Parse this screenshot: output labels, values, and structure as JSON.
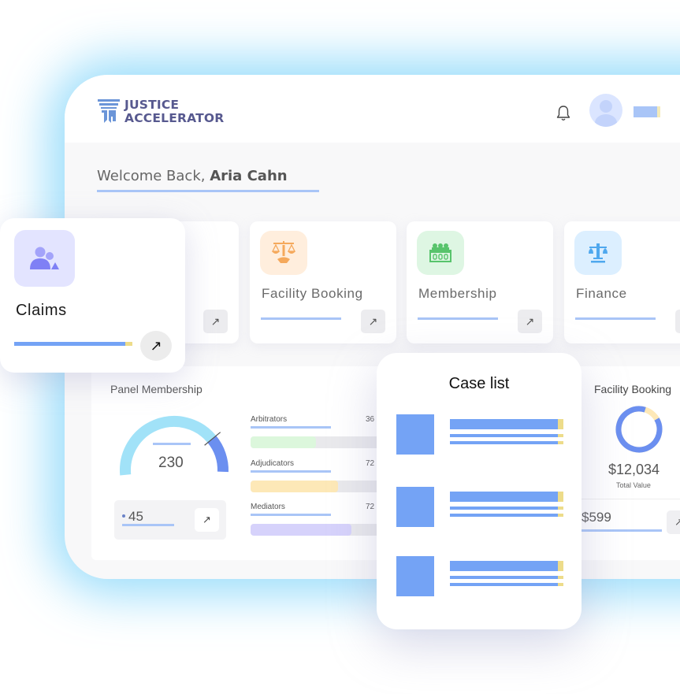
{
  "app": {
    "brand_line1": "JUSTICE",
    "brand_line2": "ACCELERATOR",
    "logo_icon": "pillar-logo-icon"
  },
  "header": {
    "notification_icon": "bell-icon",
    "avatar_icon": "user-avatar-icon"
  },
  "welcome": {
    "prefix": "Welcome Back, ",
    "name": "Aria Cahn"
  },
  "modules": [
    {
      "label": "Claims",
      "icon": "people-group-icon",
      "icon_bg": "#e3e4ff",
      "icon_color": "#7f80f5"
    },
    {
      "label": "Facility Booking",
      "icon": "scales-handshake-icon",
      "icon_bg": "#ffeedd",
      "icon_color": "#f5a95c"
    },
    {
      "label": "Membership",
      "icon": "panel-bench-icon",
      "icon_bg": "#def6e3",
      "icon_color": "#58c46c"
    },
    {
      "label": "Finance",
      "icon": "scales-icon",
      "icon_bg": "#dcefff",
      "icon_color": "#4fa8ee"
    }
  ],
  "panel_membership": {
    "title": "Panel Membership",
    "gauge_value": "230",
    "gauge_fraction": 0.78,
    "sub_value": "45",
    "rows": [
      {
        "name": "Arbitrators",
        "count": "36",
        "fraction": 0.49,
        "color": "#dcf7dc"
      },
      {
        "name": "Adjudicators",
        "count": "72",
        "fraction": 0.65,
        "color": "#fde8b7"
      },
      {
        "name": "Mediators",
        "count": "72",
        "fraction": 0.75,
        "color": "#d6d2fb"
      }
    ]
  },
  "case_list": {
    "title": "Case list",
    "items": 3
  },
  "facility_booking": {
    "title": "Facility Booking",
    "total": "$12,034",
    "total_label": "Total Value",
    "sub_value": "$599",
    "donut_fraction_primary": 0.88,
    "colors": {
      "primary": "#6b8ff0",
      "secondary": "#fde8b7"
    }
  },
  "arrow_glyph": "↗",
  "colors": {
    "accent": "#74a3f5",
    "accent_light": "#a9c5f7",
    "highlight": "#eddc8a",
    "brand_text": "#57598f",
    "glow": "#a6e1fb"
  }
}
